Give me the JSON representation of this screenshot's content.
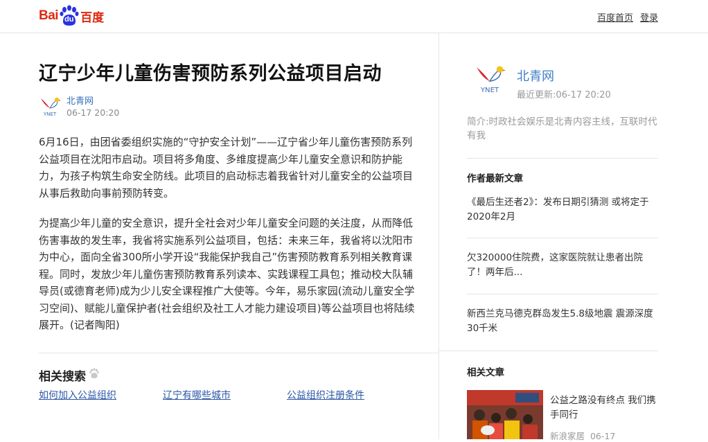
{
  "header": {
    "logo_text_left": "Bai",
    "logo_text_paw": "du",
    "logo_text_right": "百度",
    "nav": [
      "百度首页",
      "登录"
    ]
  },
  "article": {
    "title": "辽宁少年儿童伤害预防系列公益项目启动",
    "author": "北青网",
    "time": "06-17  20:20",
    "paragraphs": [
      "6月16日，由团省委组织实施的“守护安全计划”——辽宁省少年儿童伤害预防系列公益项目在沈阳市启动。项目将多角度、多维度提高少年儿童安全意识和防护能力，为孩子构筑生命安全防线。此项目的启动标志着我省针对儿童安全的公益项目从事后救助向事前预防转变。",
      "为提高少年儿童的安全意识，提升全社会对少年儿童安全问题的关注度，从而降低伤害事故的发生率，我省将实施系列公益项目，包括：未来三年，我省将以沈阳市为中心，面向全省300所小学开设“我能保护我自己”伤害预防教育系列相关教育课程。同时，发放少年儿童伤害预防教育系列读本、实践课程工具包；推动校大队辅导员(或德育老师)成为少儿安全课程推广大使等。今年，易乐家园(流动儿童安全学习空间)、赋能儿童保护者(社会组织及社工人才能力建设项目)等公益项目也将陆续展开。(记者陶阳)"
    ]
  },
  "related_search": {
    "title": "相关搜索",
    "links": [
      "如何加入公益组织",
      "辽宁有哪些城市",
      "公益组织注册条件"
    ]
  },
  "sidebar": {
    "author_name": "北青网",
    "updated": "最近更新:06-17  20:20",
    "intro": "简介:时政社会娱乐是北青内容主线，互联时代有我",
    "latest_title": "作者最新文章",
    "latest": [
      "《最后生还者2》：发布日期引猜测 或将定于2020年2月",
      "欠320000住院费，这家医院就让患者出院了！两年后...",
      "新西兰克马德克群岛发生5.8级地震 震源深度30千米"
    ],
    "related_title": "相关文章",
    "related_item": {
      "title": "公益之路没有终点 我们携手同行",
      "source": "新浪家居",
      "date": "06-17"
    }
  },
  "colors": {
    "brand_red": "#de2910",
    "brand_blue": "#2932e1",
    "link_blue": "#2a56a5",
    "author_blue": "#3e7ec7"
  },
  "icons": {
    "logo_paw": "baidu-paw-icon",
    "author_avatar": "ynet-bird-logo",
    "related_search_paw": "paw-icon"
  }
}
